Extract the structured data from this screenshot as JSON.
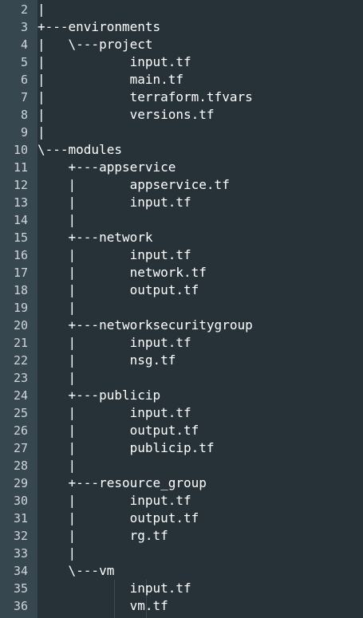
{
  "editor": {
    "lines": [
      {
        "n": "2",
        "text": "|"
      },
      {
        "n": "3",
        "text": "+---environments"
      },
      {
        "n": "4",
        "text": "|   \\---project"
      },
      {
        "n": "5",
        "text": "|           input.tf"
      },
      {
        "n": "6",
        "text": "|           main.tf"
      },
      {
        "n": "7",
        "text": "|           terraform.tfvars"
      },
      {
        "n": "8",
        "text": "|           versions.tf"
      },
      {
        "n": "9",
        "text": "|"
      },
      {
        "n": "10",
        "text": "\\---modules"
      },
      {
        "n": "11",
        "text": "    +---appservice"
      },
      {
        "n": "12",
        "text": "    |       appservice.tf"
      },
      {
        "n": "13",
        "text": "    |       input.tf"
      },
      {
        "n": "14",
        "text": "    |"
      },
      {
        "n": "15",
        "text": "    +---network"
      },
      {
        "n": "16",
        "text": "    |       input.tf"
      },
      {
        "n": "17",
        "text": "    |       network.tf"
      },
      {
        "n": "18",
        "text": "    |       output.tf"
      },
      {
        "n": "19",
        "text": "    |"
      },
      {
        "n": "20",
        "text": "    +---networksecuritygroup"
      },
      {
        "n": "21",
        "text": "    |       input.tf"
      },
      {
        "n": "22",
        "text": "    |       nsg.tf"
      },
      {
        "n": "23",
        "text": "    |"
      },
      {
        "n": "24",
        "text": "    +---publicip"
      },
      {
        "n": "25",
        "text": "    |       input.tf"
      },
      {
        "n": "26",
        "text": "    |       output.tf"
      },
      {
        "n": "27",
        "text": "    |       publicip.tf"
      },
      {
        "n": "28",
        "text": "    |"
      },
      {
        "n": "29",
        "text": "    +---resource_group"
      },
      {
        "n": "30",
        "text": "    |       input.tf"
      },
      {
        "n": "31",
        "text": "    |       output.tf"
      },
      {
        "n": "32",
        "text": "    |       rg.tf"
      },
      {
        "n": "33",
        "text": "    |"
      },
      {
        "n": "34",
        "text": "    \\---vm"
      },
      {
        "n": "35",
        "text": "            input.tf"
      },
      {
        "n": "36",
        "text": "            vm.tf"
      }
    ]
  }
}
